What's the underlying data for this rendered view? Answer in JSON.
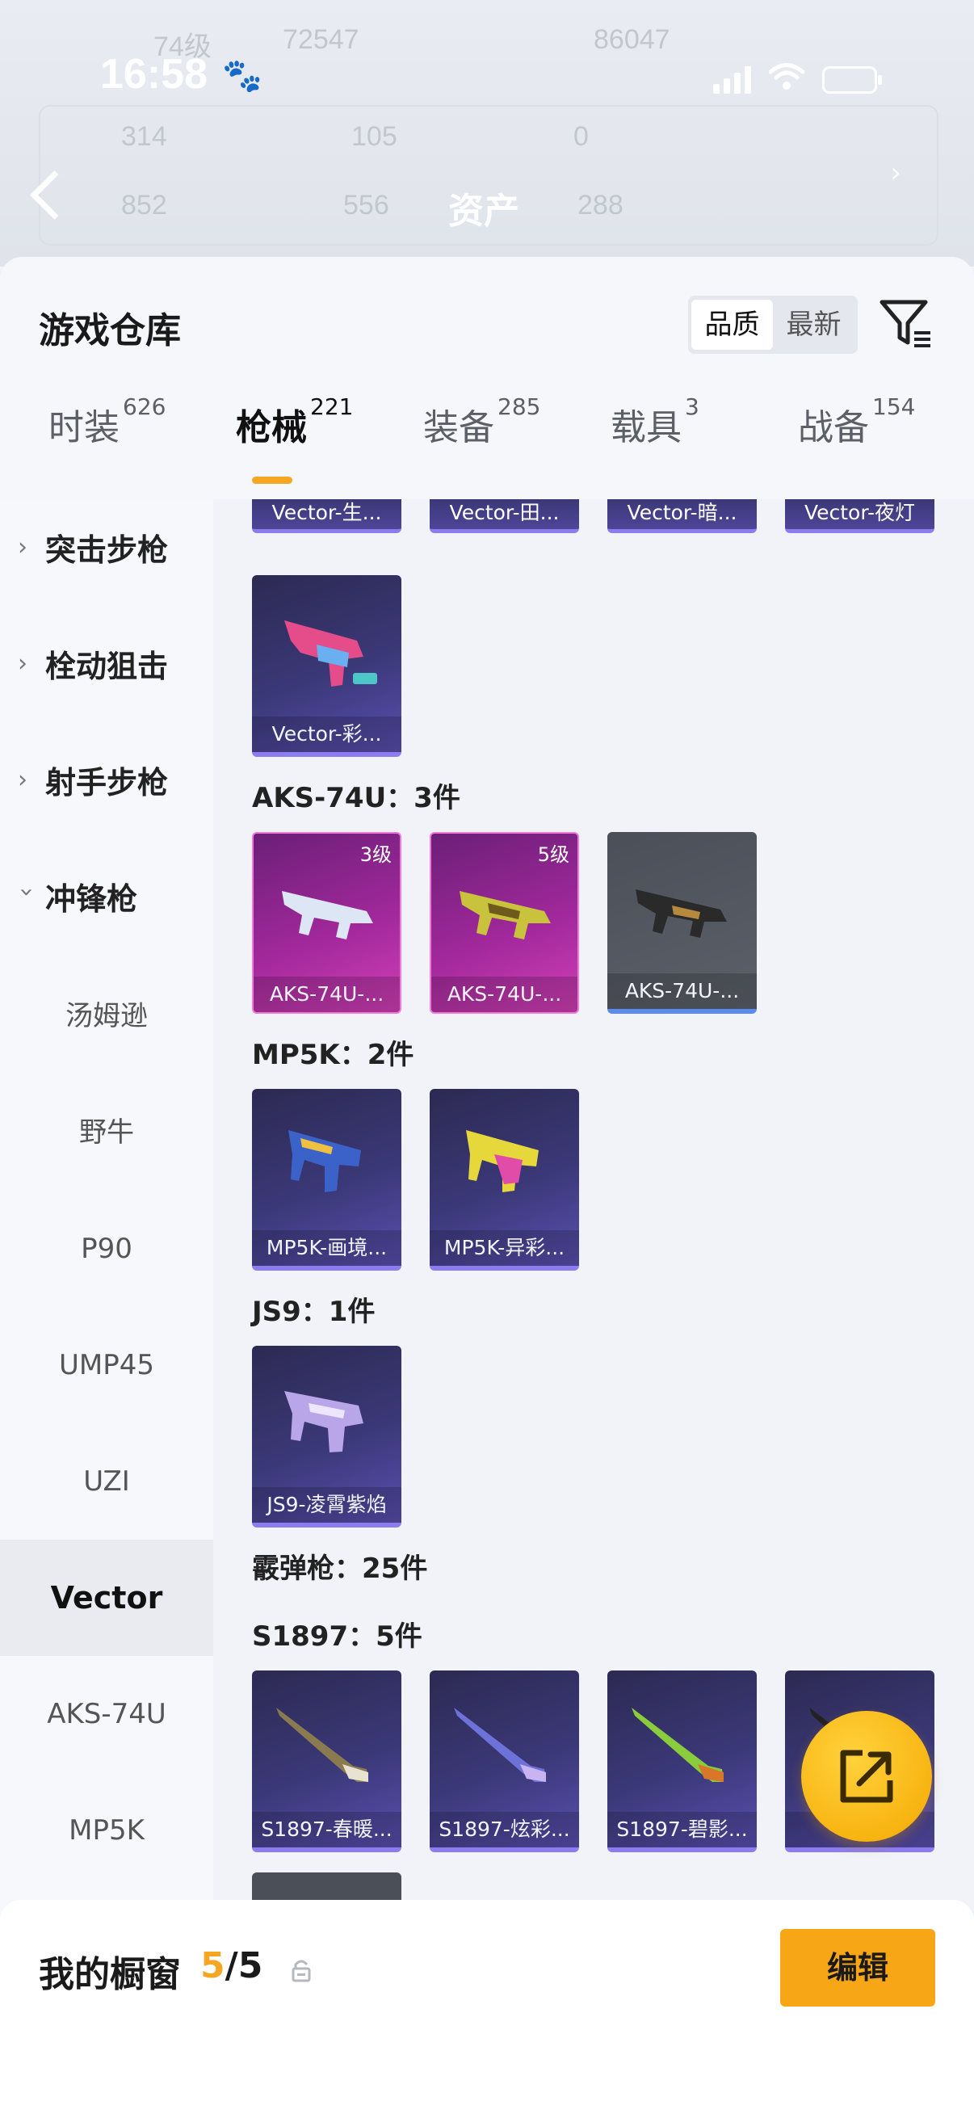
{
  "status_bar": {
    "time": "16:58",
    "paw_icon": "paw-icon",
    "signal_icon": "signal-icon",
    "wifi_icon": "wifi-icon",
    "battery_icon": "battery-icon"
  },
  "background": {
    "title": "资产",
    "ghost_values": [
      "74级",
      "72547",
      "86047",
      "314",
      "105",
      "0",
      "852",
      "556",
      "288"
    ]
  },
  "sheet": {
    "title": "游戏仓库",
    "sort": {
      "quality": "品质",
      "latest": "最新",
      "active": "品质"
    },
    "tabs": [
      {
        "label": "时装",
        "count": "626"
      },
      {
        "label": "枪械",
        "count": "221"
      },
      {
        "label": "装备",
        "count": "285"
      },
      {
        "label": "载具",
        "count": "3"
      },
      {
        "label": "战备",
        "count": "154"
      }
    ],
    "active_tab": "枪械",
    "accent_color": "#f5a623"
  },
  "sidebar": {
    "categories": [
      "突击步枪",
      "栓动狙击",
      "射手步枪",
      "冲锋枪"
    ],
    "subcategories": [
      "汤姆逊",
      "野牛",
      "P90",
      "UMP45",
      "UZI",
      "Vector",
      "AKS-74U",
      "MP5K"
    ],
    "active_sub": "Vector"
  },
  "content": {
    "partial_row": [
      "Vector-生...",
      "Vector-田...",
      "Vector-暗...",
      "Vector-夜灯"
    ],
    "vector_items": [
      "Vector-彩..."
    ],
    "groups": [
      {
        "label": "AKS-74U：3件",
        "items": [
          {
            "name": "AKS-74U-...",
            "level": "3级"
          },
          {
            "name": "AKS-74U-...",
            "level": "5级"
          },
          {
            "name": "AKS-74U-...",
            "level": ""
          }
        ]
      },
      {
        "label": "MP5K：2件",
        "items": [
          {
            "name": "MP5K-画境..."
          },
          {
            "name": "MP5K-异彩..."
          }
        ]
      },
      {
        "label": "JS9：1件",
        "items": [
          {
            "name": "JS9-凌霄紫焰"
          }
        ]
      },
      {
        "label": "霰弹枪：25件",
        "items": []
      },
      {
        "label": "S1897：5件",
        "items": [
          {
            "name": "S1897-春暖..."
          },
          {
            "name": "S1897-炫彩..."
          },
          {
            "name": "S1897-碧影..."
          },
          {
            "name": "S1..."
          }
        ]
      }
    ]
  },
  "bottom_bar": {
    "title": "我的橱窗",
    "current": "5",
    "total": "/5",
    "edit_label": "编辑"
  }
}
